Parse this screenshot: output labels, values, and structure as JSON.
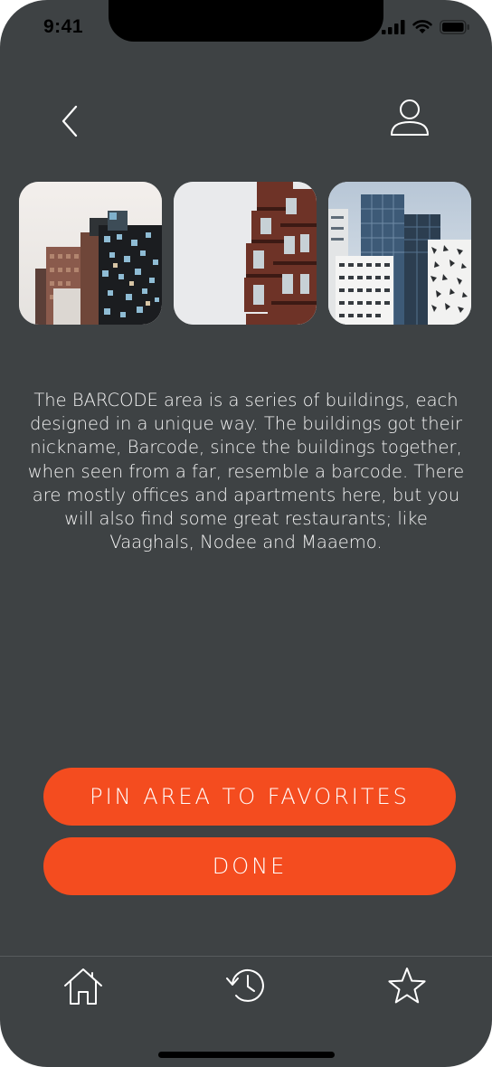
{
  "status_bar": {
    "time": "9:41"
  },
  "header": {
    "back_icon": "chevron-left-icon",
    "profile_icon": "user-icon"
  },
  "gallery": {
    "photos": [
      {
        "icon": "building-photo-1"
      },
      {
        "icon": "building-photo-2"
      },
      {
        "icon": "building-photo-3"
      }
    ]
  },
  "description": "The BARCODE area is a series of buildings, each designed in a unique way. The buildings got their nickname, Barcode, since the buildings together, when seen from a far, resemble a barcode. There are mostly offices and apartments here, but you will also find some great restaurants; like Vaaghals, Nodee and Maaemo.",
  "actions": {
    "pin_label": "PIN AREA TO FAVORITES",
    "done_label": "DONE"
  },
  "tabbar": {
    "items": [
      {
        "icon": "home-icon"
      },
      {
        "icon": "history-icon"
      },
      {
        "icon": "star-icon"
      }
    ]
  },
  "colors": {
    "background": "#3e4244",
    "accent": "#f44c1f",
    "text": "#f4f4f4"
  }
}
